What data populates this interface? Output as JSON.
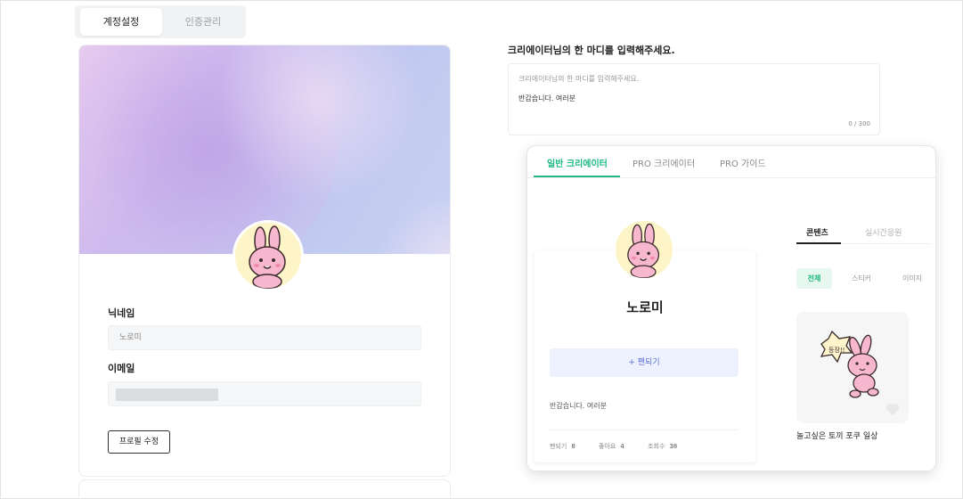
{
  "top_tabs": [
    {
      "label": "계정설정",
      "active": true
    },
    {
      "label": "인증관리",
      "active": false
    }
  ],
  "profile": {
    "nickname_label": "닉네임",
    "nickname_value": "노로미",
    "email_label": "이메일",
    "edit_button": "프로필 수정"
  },
  "oneliner": {
    "title": "크리에이터님의 한 마디를 입력해주세요.",
    "placeholder": "크리에이터님의 한 마디를 입력해주세요.",
    "value": "반갑습니다. 여러분",
    "counter": "0 / 300"
  },
  "preview": {
    "tabs": [
      "일반 크리에이터",
      "PRO 크리에이터",
      "PRO 가이드"
    ],
    "creator_name": "노로미",
    "fan_button": "+ 팬되기",
    "description": "반갑습니다. 여러분",
    "stats": [
      {
        "label": "팬되기",
        "value": "8"
      },
      {
        "label": "좋아요",
        "value": "4"
      },
      {
        "label": "조회수",
        "value": "38"
      }
    ],
    "content_tabs": [
      "콘텐츠",
      "실시간응원"
    ],
    "filters": [
      "전체",
      "스티커",
      "이미지"
    ],
    "sticker_title": "놀고싶은 토끼 포쿠 일상",
    "sticker_bubble_text": "등장!!"
  },
  "colors": {
    "accent_green": "#1fb981",
    "fan_button_bg": "#edf1fd",
    "fan_button_text": "#5a6fd6"
  }
}
